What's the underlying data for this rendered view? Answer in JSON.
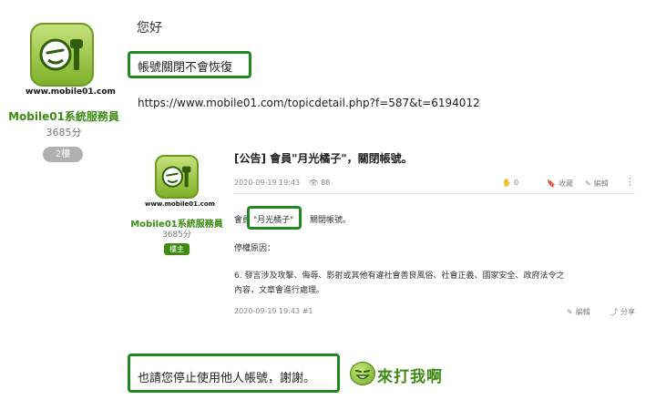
{
  "author": {
    "name": "Mobile01系統服務員",
    "points": "3685分",
    "floor": "2樓",
    "logo_caption": "www.mobile01.com"
  },
  "post": {
    "greeting": "您好",
    "highlight": "帳號關閉不會恢復",
    "url": "https://www.mobile01.com/topicdetail.php?f=587&t=6194012",
    "closing": "也請您停止使用他人帳號，謝謝。",
    "emoji_caption": "來打我啊"
  },
  "quote": {
    "title": "[公告] 會員\"月光橘子\"，關閉帳號。",
    "date": "2020-09-19 19:43",
    "views": "88",
    "likes": "0",
    "favorite_label": "收藏",
    "edit_label": "編輯",
    "more_label": "⋮",
    "author_name": "Mobile01系統服務員",
    "author_points": "3685分",
    "author_badge": "樓主",
    "logo_caption": "www.mobile01.com",
    "body_prefix": "會員",
    "body_name": "\"月光橘子\"",
    "body_suffix": "關閉帳號。",
    "reason_label": "停權原因：",
    "rule_line1": "6. 發言涉及攻擊、侮辱、影射或其他有違社會善良風俗、社會正義、國家安全、政府法令之",
    "rule_line2": "內容，文章會進行處理。",
    "footer_date": "2020-09-19 19:43 #1",
    "footer_edit": "編輯",
    "footer_share": "分享"
  },
  "colors": {
    "accent_green": "#3d8a13",
    "highlight_border": "#1f8a1f"
  }
}
